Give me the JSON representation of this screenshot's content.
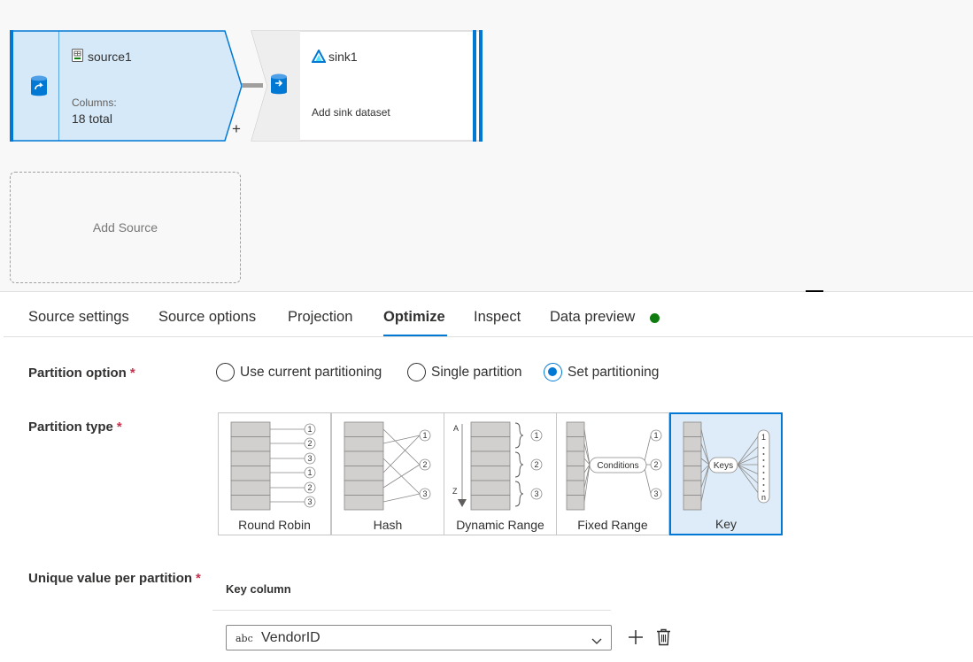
{
  "canvas": {
    "source_node": {
      "title": "source1",
      "columns_label": "Columns:",
      "columns_value": "18 total"
    },
    "sink_node": {
      "title": "sink1",
      "subtitle": "Add sink dataset"
    },
    "add_source_label": "Add Source",
    "plus_label": "+"
  },
  "tabs": [
    {
      "label": "Source settings",
      "active": false
    },
    {
      "label": "Source options",
      "active": false
    },
    {
      "label": "Projection",
      "active": false
    },
    {
      "label": "Optimize",
      "active": true
    },
    {
      "label": "Inspect",
      "active": false
    },
    {
      "label": "Data preview",
      "active": false
    }
  ],
  "data_preview_status_color": "#107c10",
  "accent_color": "#0078d4",
  "form": {
    "partition_option": {
      "label": "Partition option",
      "required": "*",
      "options": [
        {
          "label": "Use current partitioning",
          "checked": false
        },
        {
          "label": "Single partition",
          "checked": false
        },
        {
          "label": "Set partitioning",
          "checked": true
        }
      ]
    },
    "partition_type": {
      "label": "Partition type",
      "required": "*",
      "options": [
        {
          "label": "Round Robin",
          "selected": false
        },
        {
          "label": "Hash",
          "selected": false
        },
        {
          "label": "Dynamic Range",
          "selected": false
        },
        {
          "label": "Fixed Range",
          "selected": false
        },
        {
          "label": "Key",
          "selected": true
        }
      ],
      "diagram_text": {
        "round_robin_numbers": [
          "1",
          "2",
          "3",
          "1",
          "2",
          "3"
        ],
        "hash_numbers": [
          "1",
          "2",
          "3"
        ],
        "dynamic_range_letters": [
          "A",
          "Z"
        ],
        "dynamic_range_numbers": [
          "1",
          "2",
          "3"
        ],
        "fixed_range_label": "Conditions",
        "fixed_range_numbers": [
          "1",
          "2",
          "3"
        ],
        "key_label": "Keys",
        "key_numbers": [
          "1",
          "n"
        ]
      }
    },
    "unique_value": {
      "label": "Unique value per partition",
      "required": "*",
      "key_column_header": "Key column",
      "key_column": {
        "type_tag": "abc",
        "value": "VendorID"
      }
    }
  },
  "icons": [
    "dataset-icon",
    "table-icon",
    "data-factory-icon",
    "chevron-down-icon",
    "plus-icon",
    "trash-icon"
  ]
}
